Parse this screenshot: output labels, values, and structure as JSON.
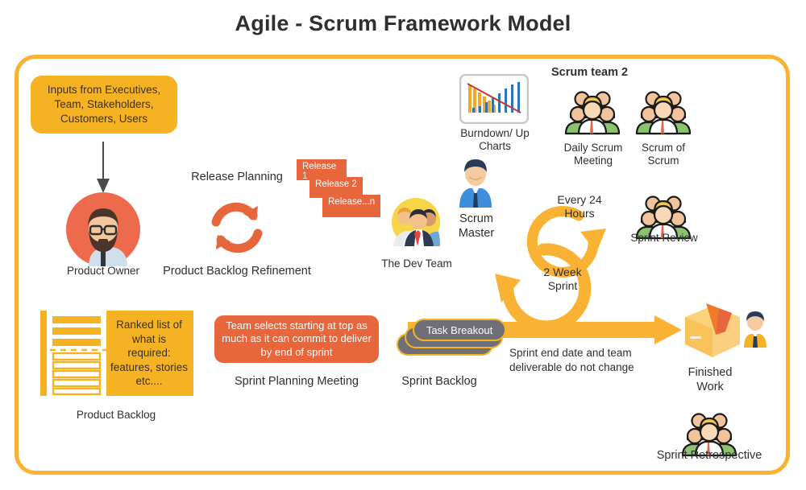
{
  "title": "Agile - Scrum Framework Model",
  "theme": {
    "frame_border": "#F9B233",
    "amber": "#F5B324",
    "orange_red": "#E8663C",
    "gray_pill": "#6F6F78",
    "text": "#2f2f2f"
  },
  "inputs_box": {
    "text": "Inputs from Executives, Team, Stakeholders, Customers, Users"
  },
  "product_owner": {
    "label": "Product Owner",
    "icon": "product-owner-avatar-icon"
  },
  "release_planning": {
    "title": "Release Planning",
    "refinement_label": "Product Backlog Refinement",
    "refresh_icon": "circular-arrows-icon",
    "cards": [
      "Release 1",
      "Release 2",
      "Release...n"
    ]
  },
  "dev_team": {
    "label": "The Dev Team",
    "icon": "dev-team-avatar-icon"
  },
  "scrum_master": {
    "label": "Scrum Master",
    "icon": "scrum-master-person-icon"
  },
  "burndown": {
    "label": "Burndown/ Up Charts",
    "icon": "burndown-chart-icon"
  },
  "scrum_team_2": {
    "heading": "Scrum team 2",
    "daily_scrum_label": "Daily Scrum Meeting",
    "daily_scrum_icon": "people-group-icon",
    "scrum_of_scrum_label": "Scrum of Scrum",
    "scrum_of_scrum_icon": "people-group-icon"
  },
  "sprint_review": {
    "label": "Sprint Review",
    "icon": "people-group-icon"
  },
  "cycles": {
    "daily_cycle_label": "Every 24 Hours",
    "sprint_cycle_label": "2 Week Sprint",
    "icon": "circular-cycle-arrows-icon"
  },
  "product_backlog": {
    "panel_text": "Ranked list of what is required: features, stories etc....",
    "label": "Product Backlog",
    "filled_items": 3,
    "outlined_items": 5
  },
  "sprint_planning": {
    "box_text": "Team selects starting at top as much as it can commit to deliver by end of sprint",
    "label": "Sprint Planning Meeting"
  },
  "sprint_backlog": {
    "top_pill_text": "Task Breakout",
    "label": "Sprint Backlog",
    "stack_count": 3
  },
  "flow_arrow": {
    "note": "Sprint end date and team deliverable do not change",
    "icon": "right-arrow-icon"
  },
  "finished_work": {
    "label": "Finished Work",
    "box_icon": "package-box-icon",
    "person_icon": "person-icon"
  },
  "sprint_retrospective": {
    "label": "Sprint Retrospective",
    "icon": "people-group-icon"
  }
}
